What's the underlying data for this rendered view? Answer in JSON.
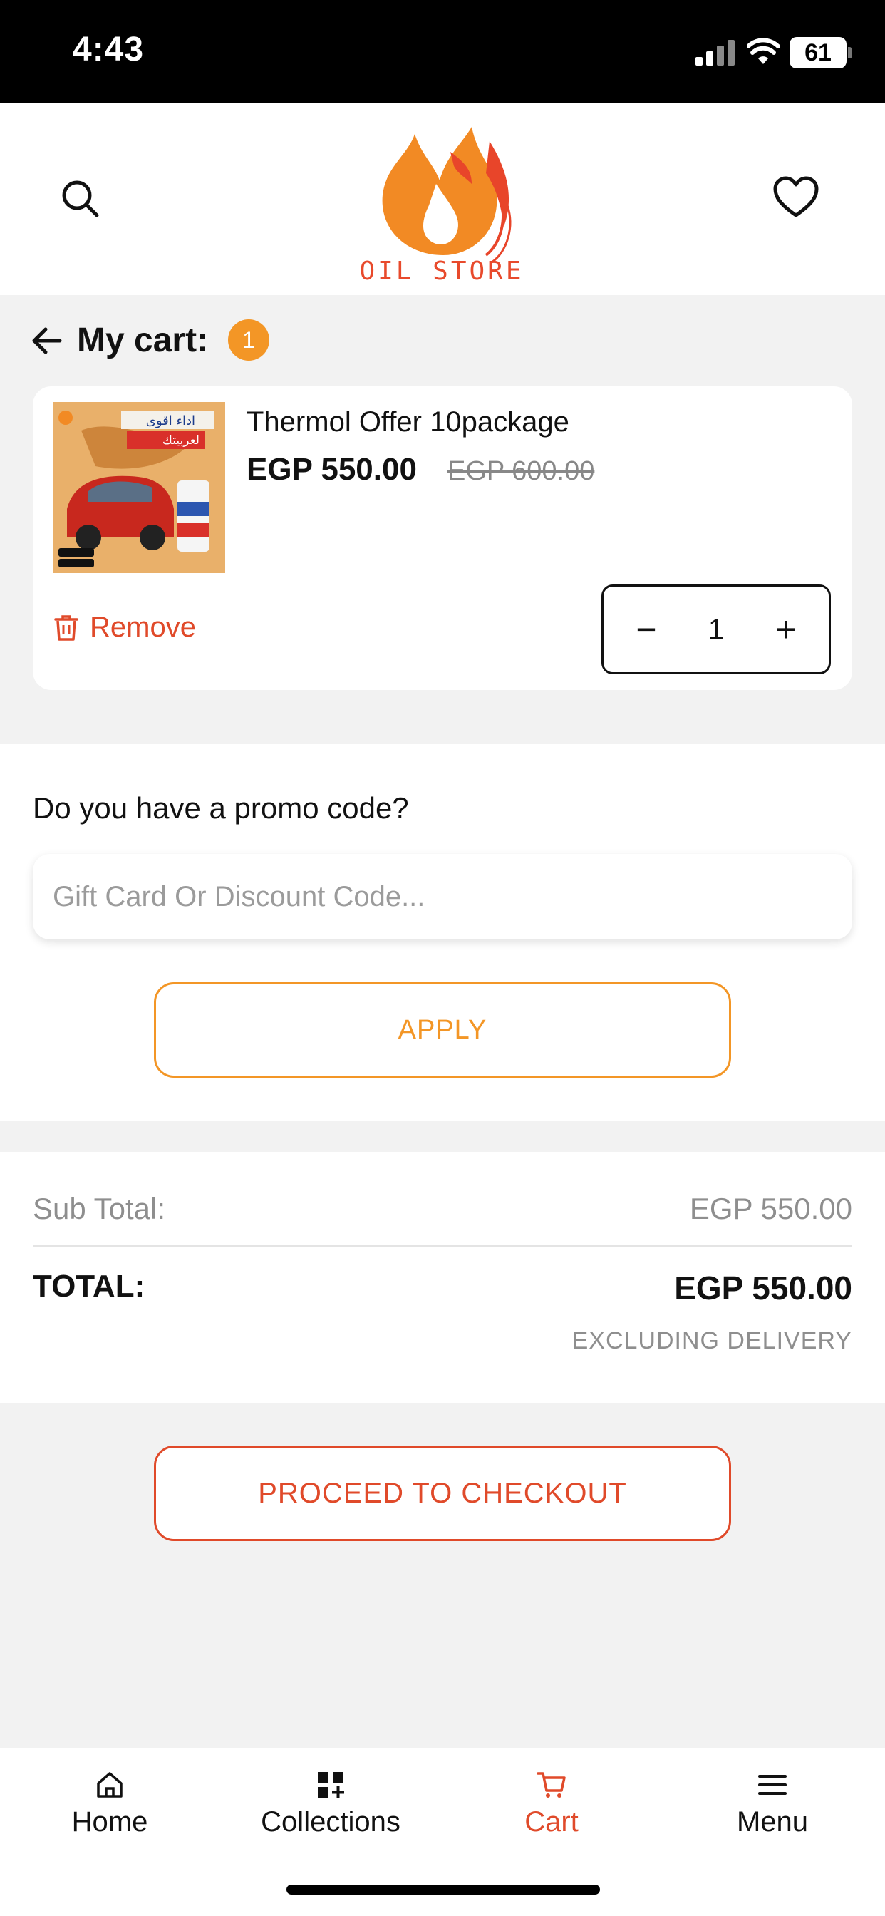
{
  "status_bar": {
    "time": "4:43",
    "battery": "61"
  },
  "header": {
    "logo_text": "OIL STORE",
    "search_icon": "search-icon",
    "heart_icon": "heart-icon"
  },
  "cart": {
    "title": "My cart:",
    "count": "1",
    "item": {
      "name": "Thermol Offer 10package",
      "price": "EGP 550.00",
      "old_price": "EGP 600.00",
      "remove_label": "Remove",
      "quantity": "1",
      "decrement_label": "−",
      "increment_label": "+",
      "image_text": "اداء اقوى لعربيتك"
    }
  },
  "promo": {
    "label": "Do you have a promo code?",
    "placeholder": "Gift Card Or Discount Code...",
    "value": "",
    "apply_label": "APPLY"
  },
  "totals": {
    "sub_label": "Sub Total:",
    "sub_value": "EGP 550.00",
    "total_label": "TOTAL:",
    "total_value": "EGP 550.00",
    "note": "EXCLUDING DELIVERY"
  },
  "checkout": {
    "label": "PROCEED TO CHECKOUT"
  },
  "nav": {
    "items": [
      {
        "label": "Home",
        "icon": "home-icon"
      },
      {
        "label": "Collections",
        "icon": "collections-icon"
      },
      {
        "label": "Cart",
        "icon": "cart-icon"
      },
      {
        "label": "Menu",
        "icon": "menu-icon"
      }
    ],
    "active": "Cart"
  },
  "colors": {
    "accent_orange": "#f39626",
    "accent_red": "#e04a2a",
    "background": "#f2f2f2"
  }
}
